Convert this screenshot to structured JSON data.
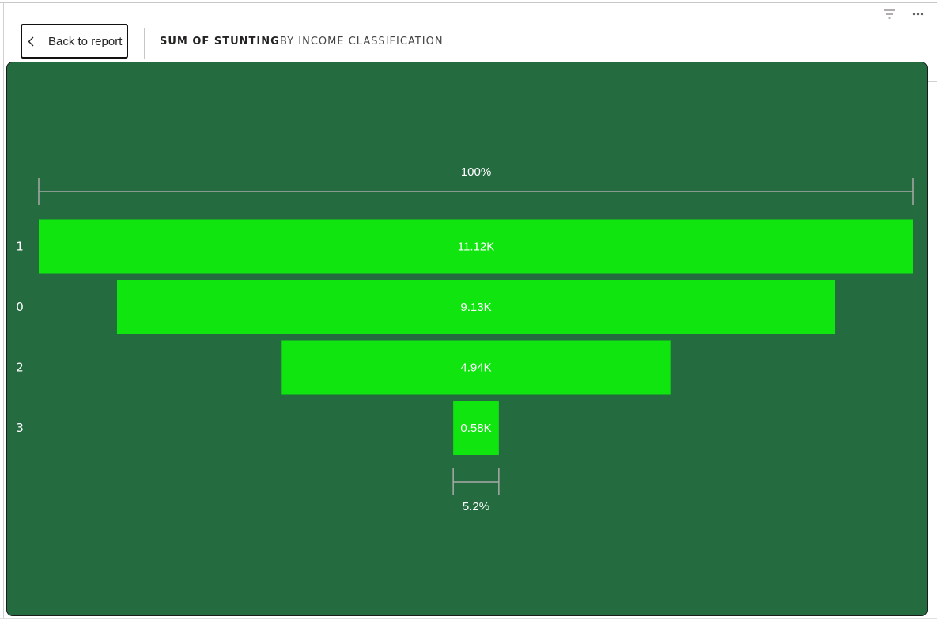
{
  "header": {
    "back_label": "Back to report",
    "title": "SUM OF STUNTING",
    "subtitle": "BY INCOME CLASSIFICATION"
  },
  "toolbar": {
    "icons": [
      "filter-icon",
      "more-options-icon"
    ]
  },
  "colors": {
    "panel_background": "#246b40",
    "bar_fill": "#10e510",
    "text": "#ffffff",
    "bracket": "#a9a9a9"
  },
  "chart_data": {
    "type": "funnel",
    "title": "SUM OF STUNTING",
    "subtitle": "BY INCOME CLASSIFICATION",
    "categories": [
      "1",
      "0",
      "2",
      "3"
    ],
    "values": [
      11120,
      9130,
      4940,
      580
    ],
    "data_labels": [
      "11.12K",
      "9.13K",
      "4.94K",
      "0.58K"
    ],
    "top_percent_label": "100%",
    "bottom_percent_label": "5.2%",
    "grid": false,
    "legend": "none"
  }
}
